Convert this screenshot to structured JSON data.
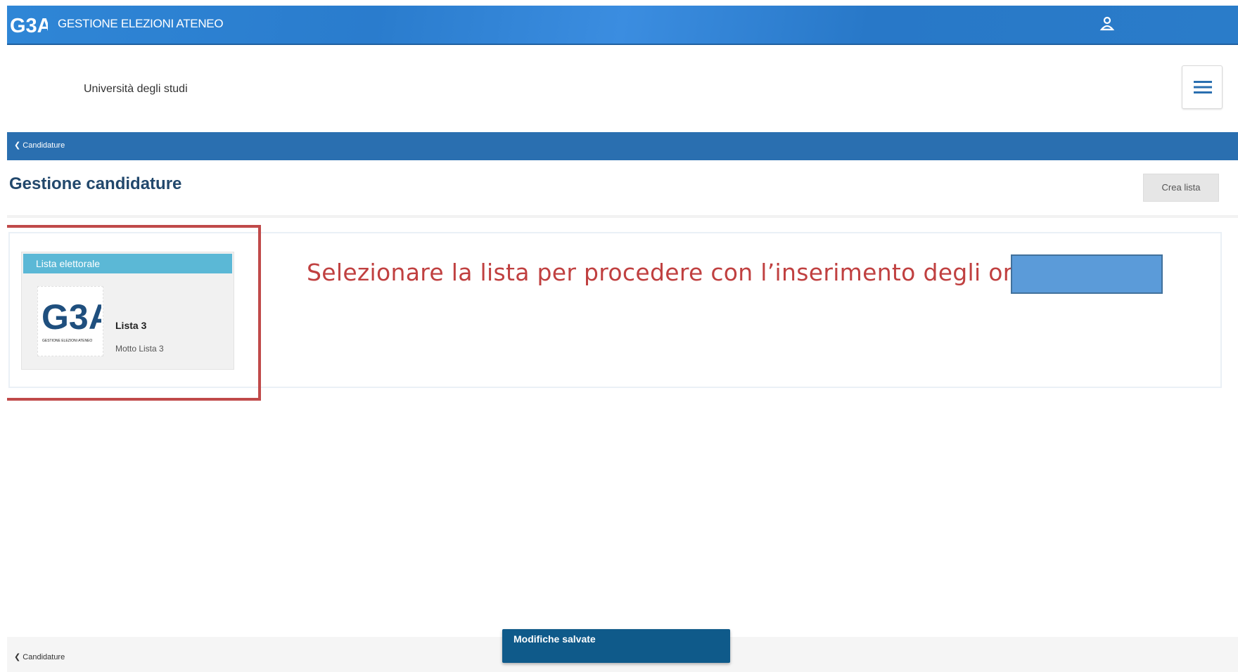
{
  "topbar": {
    "logo_text": "G3A",
    "app_title": "GESTIONE ELEZIONI ATENEO",
    "user_icon": "user-icon"
  },
  "header": {
    "university_name": "Università degli studi",
    "menu_icon": "hamburger-icon"
  },
  "breadcrumb": {
    "back_label": "Candidature"
  },
  "page": {
    "title": "Gestione candidature",
    "create_button_label": "Crea lista"
  },
  "lists": [
    {
      "header": "Lista elettorale",
      "logo_text": "G3A",
      "logo_subtitle": "GESTIONE ELEZIONI ATENEO",
      "name": "Lista 3",
      "motto": "Motto Lista 3"
    }
  ],
  "annotation": {
    "instruction": "Selezionare la lista per procedere con l’inserimento degli organi",
    "highlight_color": "#c04a4a"
  },
  "footer": {
    "back_label": "Candidature"
  },
  "toast": {
    "message": "Modifiche salvate"
  },
  "colors": {
    "primary": "#2a7ccd",
    "breadcrumb_bar": "#2a6fb0",
    "card_header": "#5bb8d6",
    "toast": "#0f5a8a",
    "title": "#22486c"
  }
}
